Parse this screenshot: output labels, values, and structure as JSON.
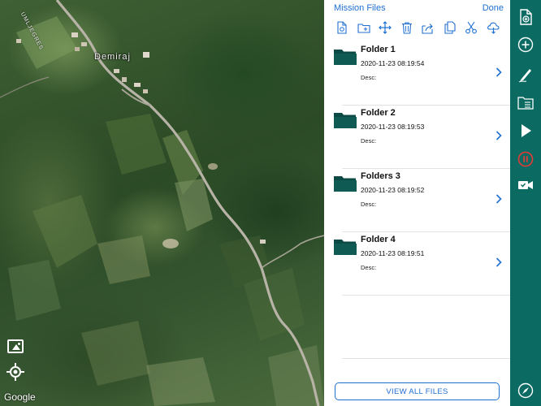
{
  "map": {
    "place_label": "Demiraj",
    "street_label": "UMLJEGRES",
    "attribution": "Google"
  },
  "panel": {
    "title": "Mission Files",
    "done_label": "Done",
    "toolbar": [
      {
        "icon": "new-file-icon"
      },
      {
        "icon": "new-folder-icon"
      },
      {
        "icon": "move-icon"
      },
      {
        "icon": "trash-icon"
      },
      {
        "icon": "share-icon"
      },
      {
        "icon": "duplicate-icon"
      },
      {
        "icon": "cut-icon"
      },
      {
        "icon": "cloud-download-icon"
      }
    ],
    "files": [
      {
        "name": "Folder 1",
        "date": "2020-11-23 08:19:54",
        "desc": "Desc:"
      },
      {
        "name": "Folder 2",
        "date": "2020-11-23 08:19:53",
        "desc": "Desc:"
      },
      {
        "name": "Folders 3",
        "date": "2020-11-23 08:19:52",
        "desc": "Desc:"
      },
      {
        "name": "Folder 4",
        "date": "2020-11-23 08:19:51",
        "desc": "Desc:"
      }
    ],
    "view_all_label": "VIEW ALL FILES"
  },
  "rightbar": {
    "icons": [
      "add-file-icon",
      "add-circle-icon",
      "draw-icon",
      "folder-list-icon",
      "play-icon",
      "record-icon",
      "video-camera-icon",
      "compass-icon"
    ]
  },
  "colors": {
    "accent": "#1f6fd1",
    "sidebar": "#0b6b63",
    "folder": "#0c4a45",
    "record": "#e53935"
  }
}
